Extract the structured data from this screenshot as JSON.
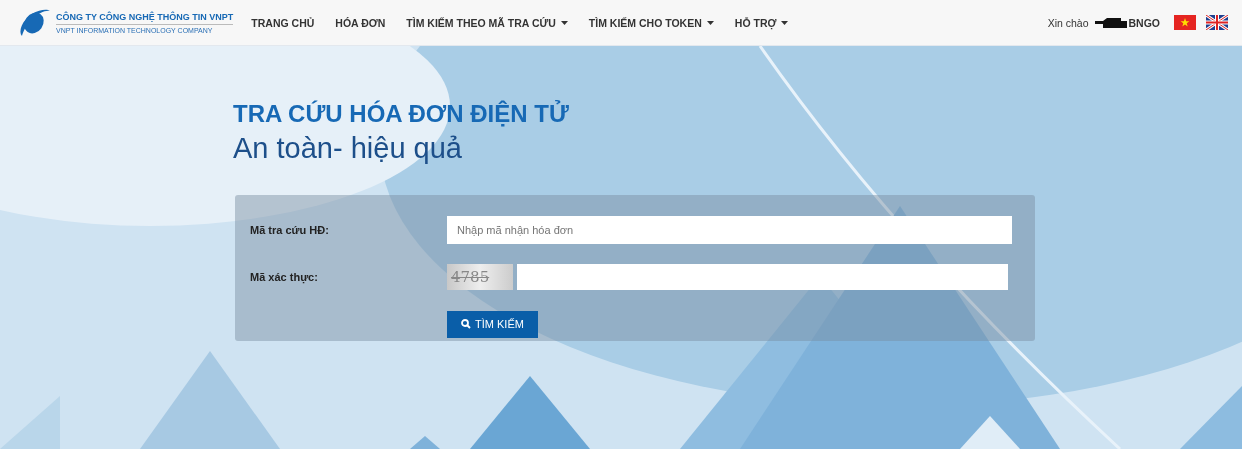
{
  "logo": {
    "title": "CÔNG TY CÔNG NGHỆ THÔNG TIN VNPT",
    "subtitle": "VNPT INFORMATION TECHNOLOGY COMPANY"
  },
  "nav": [
    {
      "label": "TRANG CHỦ",
      "dropdown": false
    },
    {
      "label": "HÓA ĐƠN",
      "dropdown": false
    },
    {
      "label": "TÌM KIẾM THEO MÃ TRA CỨU",
      "dropdown": true
    },
    {
      "label": "TÌM KIẾM CHO TOKEN",
      "dropdown": true
    },
    {
      "label": "HỖ TRỢ",
      "dropdown": true
    }
  ],
  "user": {
    "greeting": "Xin chào",
    "name_visible": "BNGO"
  },
  "languages": [
    {
      "kind": "vietnam"
    },
    {
      "kind": "uk"
    }
  ],
  "hero": {
    "title": "TRA CỨU HÓA ĐƠN ĐIỆN TỬ",
    "subtitle": "An toàn- hiệu quả"
  },
  "form": {
    "lookup_label": "Mã tra cứu HĐ:",
    "lookup_placeholder": "Nhập mã nhận hóa đơn",
    "captcha_label": "Mã xác thực:",
    "captcha_text": "4785",
    "search_button": "TÌM KIẾM"
  }
}
